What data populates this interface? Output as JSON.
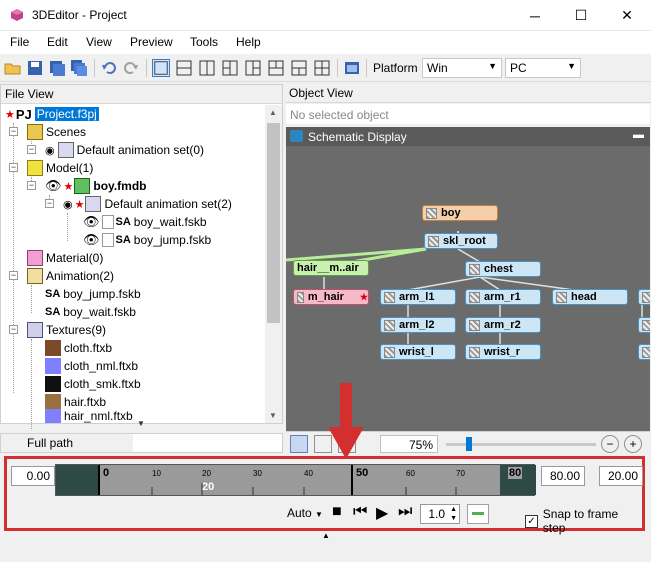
{
  "window": {
    "title": "3DEditor - Project",
    "minimize": "─",
    "maximize": "☐",
    "close": "✕"
  },
  "menu": [
    "File",
    "Edit",
    "View",
    "Preview",
    "Tools",
    "Help"
  ],
  "toolbar": {
    "platform_label": "Platform",
    "platform_value": "Win",
    "target_value": "PC"
  },
  "file_view": {
    "header": "File View",
    "footer": "Full path",
    "tree": {
      "project": "Project.f3pj",
      "scenes": "Scenes",
      "scene_anim": "Default animation set(0)",
      "model": "Model(1)",
      "model_file": "boy.fmdb",
      "model_anim": "Default animation set(2)",
      "anim_wait": "boy_wait.fskb",
      "anim_jump": "boy_jump.fskb",
      "material": "Material(0)",
      "animation": "Animation(2)",
      "animation_items": [
        "boy_jump.fskb",
        "boy_wait.fskb"
      ],
      "textures": "Textures(9)",
      "texture_items": [
        "cloth.ftxb",
        "cloth_nml.ftxb",
        "cloth_smk.ftxb",
        "hair.ftxb",
        "hair_nml.ftxb"
      ]
    }
  },
  "object_view": {
    "header": "Object View",
    "status": "No selected object",
    "schematic_title": "Schematic Display",
    "zoom": "75%",
    "nodes": {
      "boy": "boy",
      "skl_root": "skl_root",
      "hair": "hair__m..air",
      "chest": "chest",
      "m_hair": "m_hair",
      "arm_l1": "arm_l1",
      "arm_r1": "arm_r1",
      "head": "head",
      "arm_l2": "arm_l2",
      "arm_r2": "arm_r2",
      "wrist_l": "wrist_l",
      "wrist_r": "wrist_r"
    }
  },
  "timeline": {
    "start": "0.00",
    "end": "80.00",
    "fps": "20.00",
    "ticks": [
      "0",
      "10",
      "20",
      "30",
      "40",
      "50",
      "60",
      "70",
      "80"
    ],
    "range_start_label": "20",
    "mode": "Auto",
    "speed": "1.0",
    "snap_label": "Snap to frame step",
    "snap_checked": true
  },
  "colors": {
    "accent_red": "#d32f2f",
    "selection": "#0078d7",
    "schematic_bg": "#6b6b6b",
    "node_blue": "#cce6f6",
    "node_orange": "#f5cfa9",
    "node_green": "#c8f0b0",
    "node_pink": "#f7b8c8"
  }
}
